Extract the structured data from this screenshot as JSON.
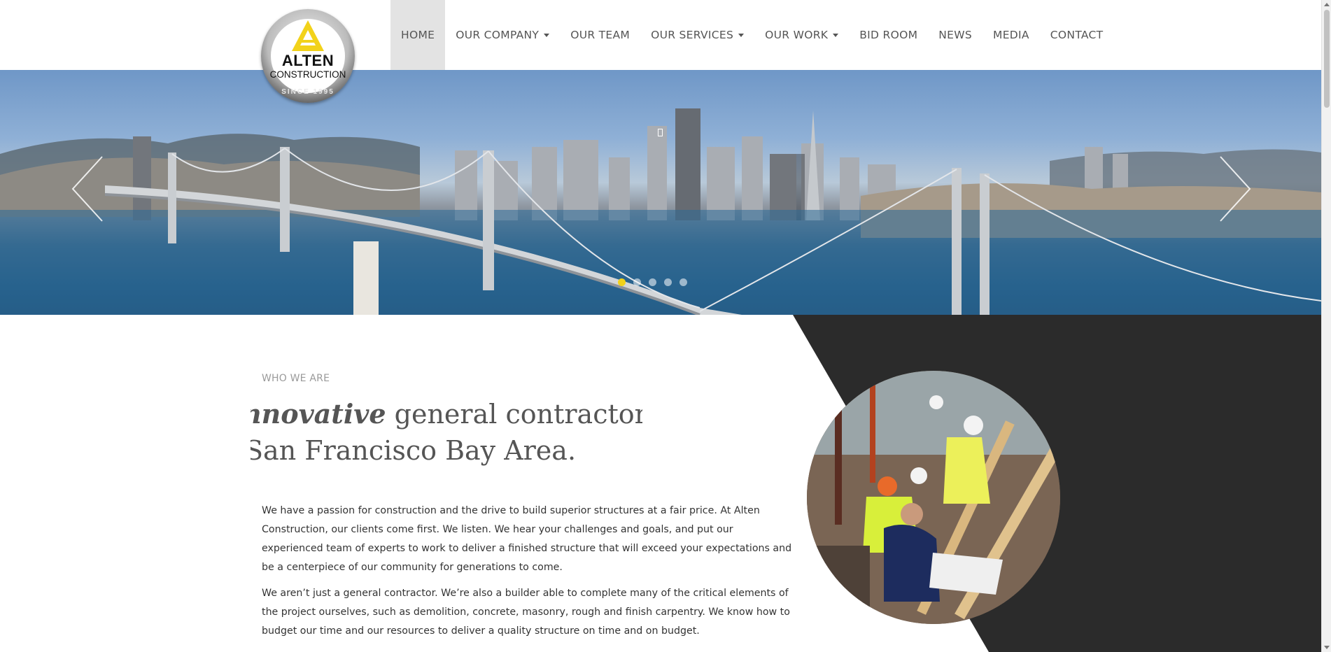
{
  "brand": {
    "logo_name": "ALTEN",
    "logo_sub": "CONSTRUCTION",
    "logo_since": "SINCE 1995",
    "accent_color": "#f2d21a"
  },
  "nav": {
    "items": [
      {
        "label": "HOME",
        "active": true,
        "dropdown": false
      },
      {
        "label": "OUR COMPANY",
        "active": false,
        "dropdown": true
      },
      {
        "label": "OUR TEAM",
        "active": false,
        "dropdown": false
      },
      {
        "label": "OUR SERVICES",
        "active": false,
        "dropdown": true
      },
      {
        "label": "OUR WORK",
        "active": false,
        "dropdown": true
      },
      {
        "label": "BID ROOM",
        "active": false,
        "dropdown": false
      },
      {
        "label": "NEWS",
        "active": false,
        "dropdown": false
      },
      {
        "label": "MEDIA",
        "active": false,
        "dropdown": false
      },
      {
        "label": "CONTACT",
        "active": false,
        "dropdown": false
      }
    ]
  },
  "hero": {
    "prev_icon": "chevron-left-icon",
    "next_icon": "chevron-right-icon",
    "slide_count": 5,
    "active_slide": 1
  },
  "about": {
    "eyebrow": "WHO WE ARE",
    "headline_line1_emph": "nnovative",
    "headline_line1_rest": " general contractor",
    "headline_line2": "San Francisco Bay Area.",
    "paragraph1": "We have a passion for construction and the drive to build superior structures at a fair price. At Alten Construction, our clients come first. We listen. We hear your challenges and goals, and put our experienced team of experts to work to deliver a finished structure that will exceed your expectations and be a centerpiece of our community for generations to come.",
    "paragraph2": "We aren’t just a general contractor. We’re also a builder able to complete many of the critical elements of the project ourselves, such as demolition, concrete, masonry, rough and finish carpentry. We know how to budget our time and our resources to deliver a quality structure on time and on budget."
  },
  "colors": {
    "dark_panel": "#2b2b2b",
    "nav_text": "#555555",
    "nav_active_bg": "#e3e3e3"
  }
}
